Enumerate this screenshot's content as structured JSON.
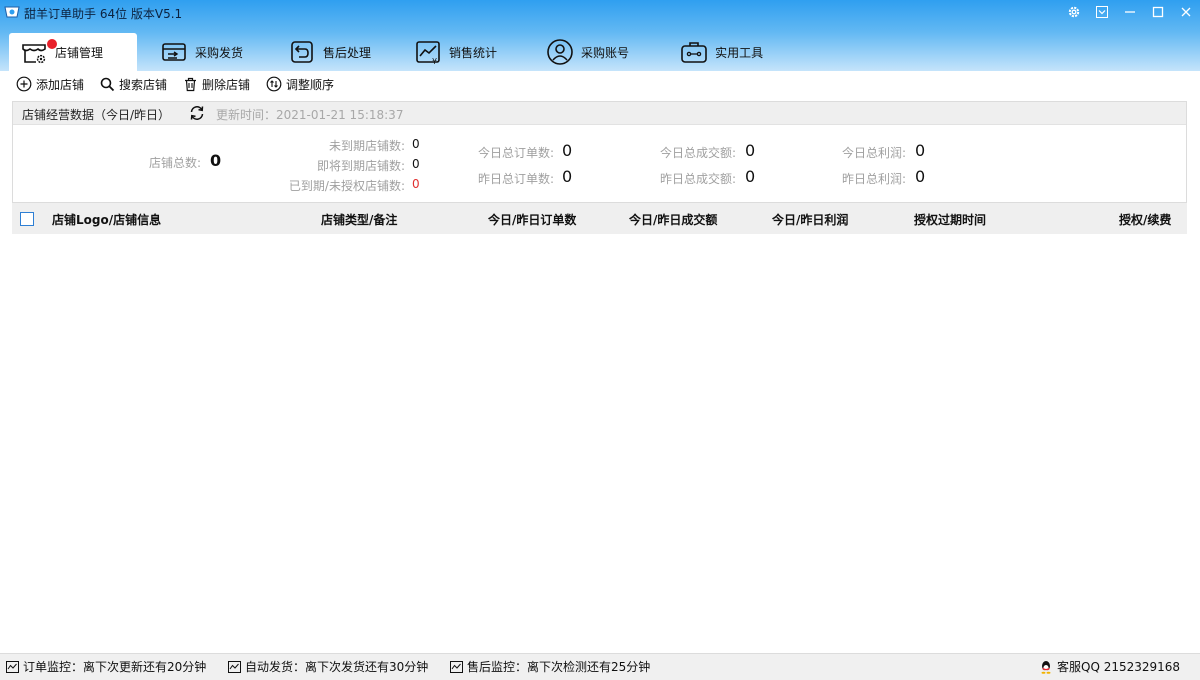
{
  "window": {
    "title": "甜羊订单助手 64位  版本V5.1"
  },
  "tabs": [
    {
      "label": "店铺管理",
      "icon": "store-settings-icon",
      "active": true
    },
    {
      "label": "采购发货",
      "icon": "delivery-card-icon",
      "active": false
    },
    {
      "label": "售后处理",
      "icon": "return-icon",
      "active": false
    },
    {
      "label": "销售统计",
      "icon": "sales-chart-icon",
      "active": false
    },
    {
      "label": "采购账号",
      "icon": "account-icon",
      "active": false
    },
    {
      "label": "实用工具",
      "icon": "toolbox-icon",
      "active": false
    }
  ],
  "toolbar": {
    "add": "添加店铺",
    "search": "搜索店铺",
    "delete": "删除店铺",
    "reorder": "调整顺序"
  },
  "stats": {
    "title": "店铺经营数据（今日/昨日）",
    "update_time": "更新时间：2021-01-21 15:18:37",
    "total_label": "店铺总数:",
    "total_value": "0",
    "not_expired_label": "未到期店铺数:",
    "not_expired_value": "0",
    "expiring_label": "即将到期店铺数:",
    "expiring_value": "0",
    "expired_label": "已到期/未授权店铺数:",
    "expired_value": "0",
    "today_orders_label": "今日总订单数:",
    "today_orders_value": "0",
    "yesterday_orders_label": "昨日总订单数:",
    "yesterday_orders_value": "0",
    "today_gmv_label": "今日总成交额:",
    "today_gmv_value": "0",
    "yesterday_gmv_label": "昨日总成交额:",
    "yesterday_gmv_value": "0",
    "today_profit_label": "今日总利润:",
    "today_profit_value": "0",
    "yesterday_profit_label": "昨日总利润:",
    "yesterday_profit_value": "0"
  },
  "table": {
    "headers": [
      "店铺Logo/店铺信息",
      "店铺类型/备注",
      "今日/昨日订单数",
      "今日/昨日成交额",
      "今日/昨日利润",
      "授权过期时间",
      "授权/续费"
    ]
  },
  "status": {
    "order_monitor": "订单监控：离下次更新还有20分钟",
    "auto_ship": "自动发货：离下次发货还有30分钟",
    "after_sale": "售后监控：离下次检测还有25分钟",
    "service_qq": "客服QQ 2152329168"
  },
  "colors": {
    "title_gradient_top": "#2f9ff0",
    "checkbox_border": "#2e7fd4",
    "notice_dot": "#e8202a",
    "expired_value": "#e03030"
  }
}
